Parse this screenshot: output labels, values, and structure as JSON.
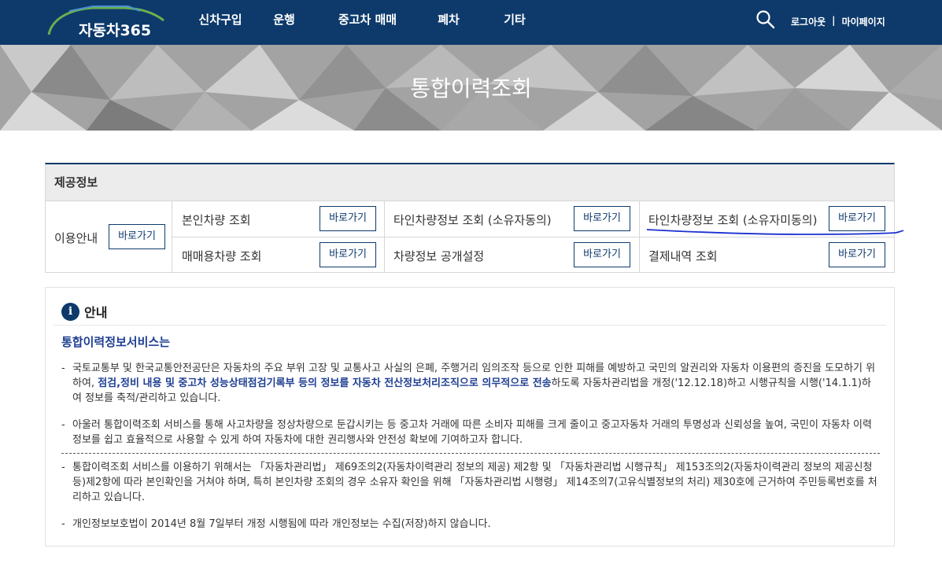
{
  "header": {
    "logo": "자동차365",
    "nav": [
      "신차구입",
      "운행",
      "중고차 매매",
      "폐차",
      "기타"
    ],
    "util": {
      "logout": "로그아웃",
      "divider": "|",
      "mypage": "마이페이지"
    },
    "icons": {
      "search": "search-icon"
    }
  },
  "hero": {
    "title": "통합이력조회"
  },
  "panel": {
    "title": "제공정보",
    "usage_label": "이용안내",
    "go_label": "바로가기",
    "items": [
      {
        "label": "본인차량 조회"
      },
      {
        "label": "타인차량정보 조회 (소유자동의)"
      },
      {
        "label": "타인차량정보 조회 (소유자미동의)"
      },
      {
        "label": "매매용차량 조회"
      },
      {
        "label": "차량정보 공개설정"
      },
      {
        "label": "결제내역 조회"
      }
    ]
  },
  "info": {
    "title": "안내",
    "subtitle": "통합이력정보서비스는",
    "dash": "-",
    "p1_pre": "국토교통부 및 한국교통안전공단은 자동차의 주요 부위 고장 및 교통사고 사실의 은폐, 주행거리 임의조작 등으로 인한 피해를 예방하고 국민의 알권리와 자동차 이용편의 증진을 도모하기 위하여, ",
    "p1_bold": "점검,정비 내용 및 중고차 성능상태점검기록부 등의 정보를 자동차 전산정보처리조직으로 의무적으로 전송",
    "p1_post": "하도록 자동차관리법을 개정('12.12.18)하고 시행규칙을 시행('14.1.1)하여 정보를 축적/관리하고 있습니다.",
    "p2": "아울러 통합이력조회 서비스를 통해 사고차량을 정상차량으로 둔갑시키는 등 중고차 거래에 따른 소비자 피해를 크게 줄이고 중고자동차 거래의 투명성과 신뢰성을 높여, 국민이 자동차 이력정보를 쉽고 효율적으로 사용할 수 있게 하여 자동차에 대한 권리행사와 안전성 확보에 기여하고자 합니다.",
    "p3": "통합이력조회 서비스를 이용하기 위해서는 「자동차관리법」 제69조의2(자동차이력관리 정보의 제공) 제2항 및 「자동차관리법 시행규칙」 제153조의2(자동차이력관리 정보의 제공신청 등)제2항에 따라 본인확인을 거쳐야 하며, 특히 본인차량 조회의 경우 소유자 확인을 위해 「자동차관리법 시행령」 제14조의7(고유식별정보의 처리) 제30호에 근거하여 주민등록번호를 처리하고 있습니다.",
    "p4": "개인정보보호법이 2014년 8월 7일부터 개정 시행됨에 따라 개인정보는 수집(저장)하지 않습니다."
  }
}
